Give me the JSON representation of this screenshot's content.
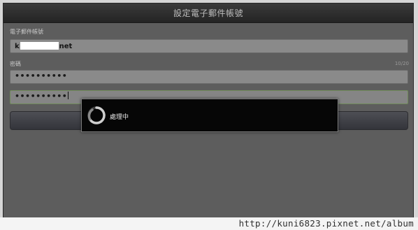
{
  "window": {
    "title": "設定電子郵件帳號"
  },
  "form": {
    "email_label": "電子郵件帳號",
    "email_prefix": "k",
    "email_suffix": "net",
    "password_label": "密碼",
    "password_counter": "10/20",
    "password_value": "••••••••••",
    "confirm_value": "••••••••••"
  },
  "dialog": {
    "message": "處理中",
    "icon": "spinner-icon"
  },
  "watermark": {
    "text": "http://kuni6823.pixnet.net/album"
  },
  "colors": {
    "background": "#5d5d5d",
    "titlebar": "#2e2e2e",
    "field": "#8a8a8a",
    "dialog": "#060606"
  }
}
